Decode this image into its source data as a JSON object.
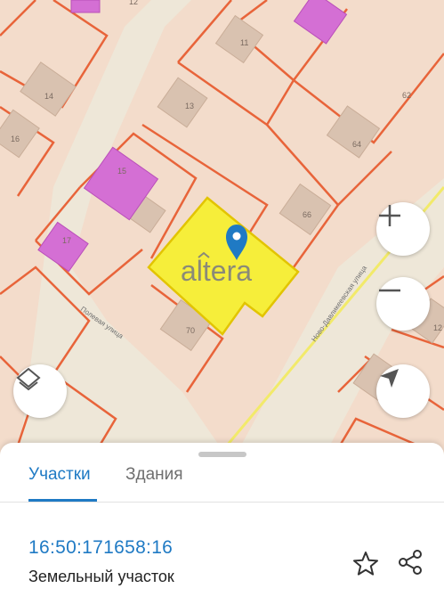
{
  "map": {
    "lot_numbers": [
      "12",
      "11",
      "14",
      "13",
      "62",
      "16",
      "64",
      "15",
      "66",
      "17",
      "70",
      "12"
    ],
    "streets": [
      "Полевая улица",
      "Ново-Давликеевская улица"
    ],
    "watermark": "altera",
    "colors": {
      "background": "#f3dccb",
      "road": "#eee7d8",
      "parcel_border": "#e8643a",
      "building": "#d9c2b0",
      "special_building": "#d46fd4",
      "selected_parcel": "#f6ee3a",
      "marker": "#1f7ac4",
      "road_line": "#f2ea6a"
    },
    "controls": {
      "zoom_in": "plus-icon",
      "zoom_out": "minus-icon",
      "layers": "layers-icon",
      "locate": "navigation-arrow-icon"
    }
  },
  "sheet": {
    "tabs": [
      {
        "label": "Участки",
        "active": true
      },
      {
        "label": "Здания",
        "active": false
      }
    ],
    "cadastral_number": "16:50:171658:16",
    "object_type": "Земельный участок",
    "actions": {
      "favorite": "star-icon",
      "share": "share-icon"
    }
  }
}
